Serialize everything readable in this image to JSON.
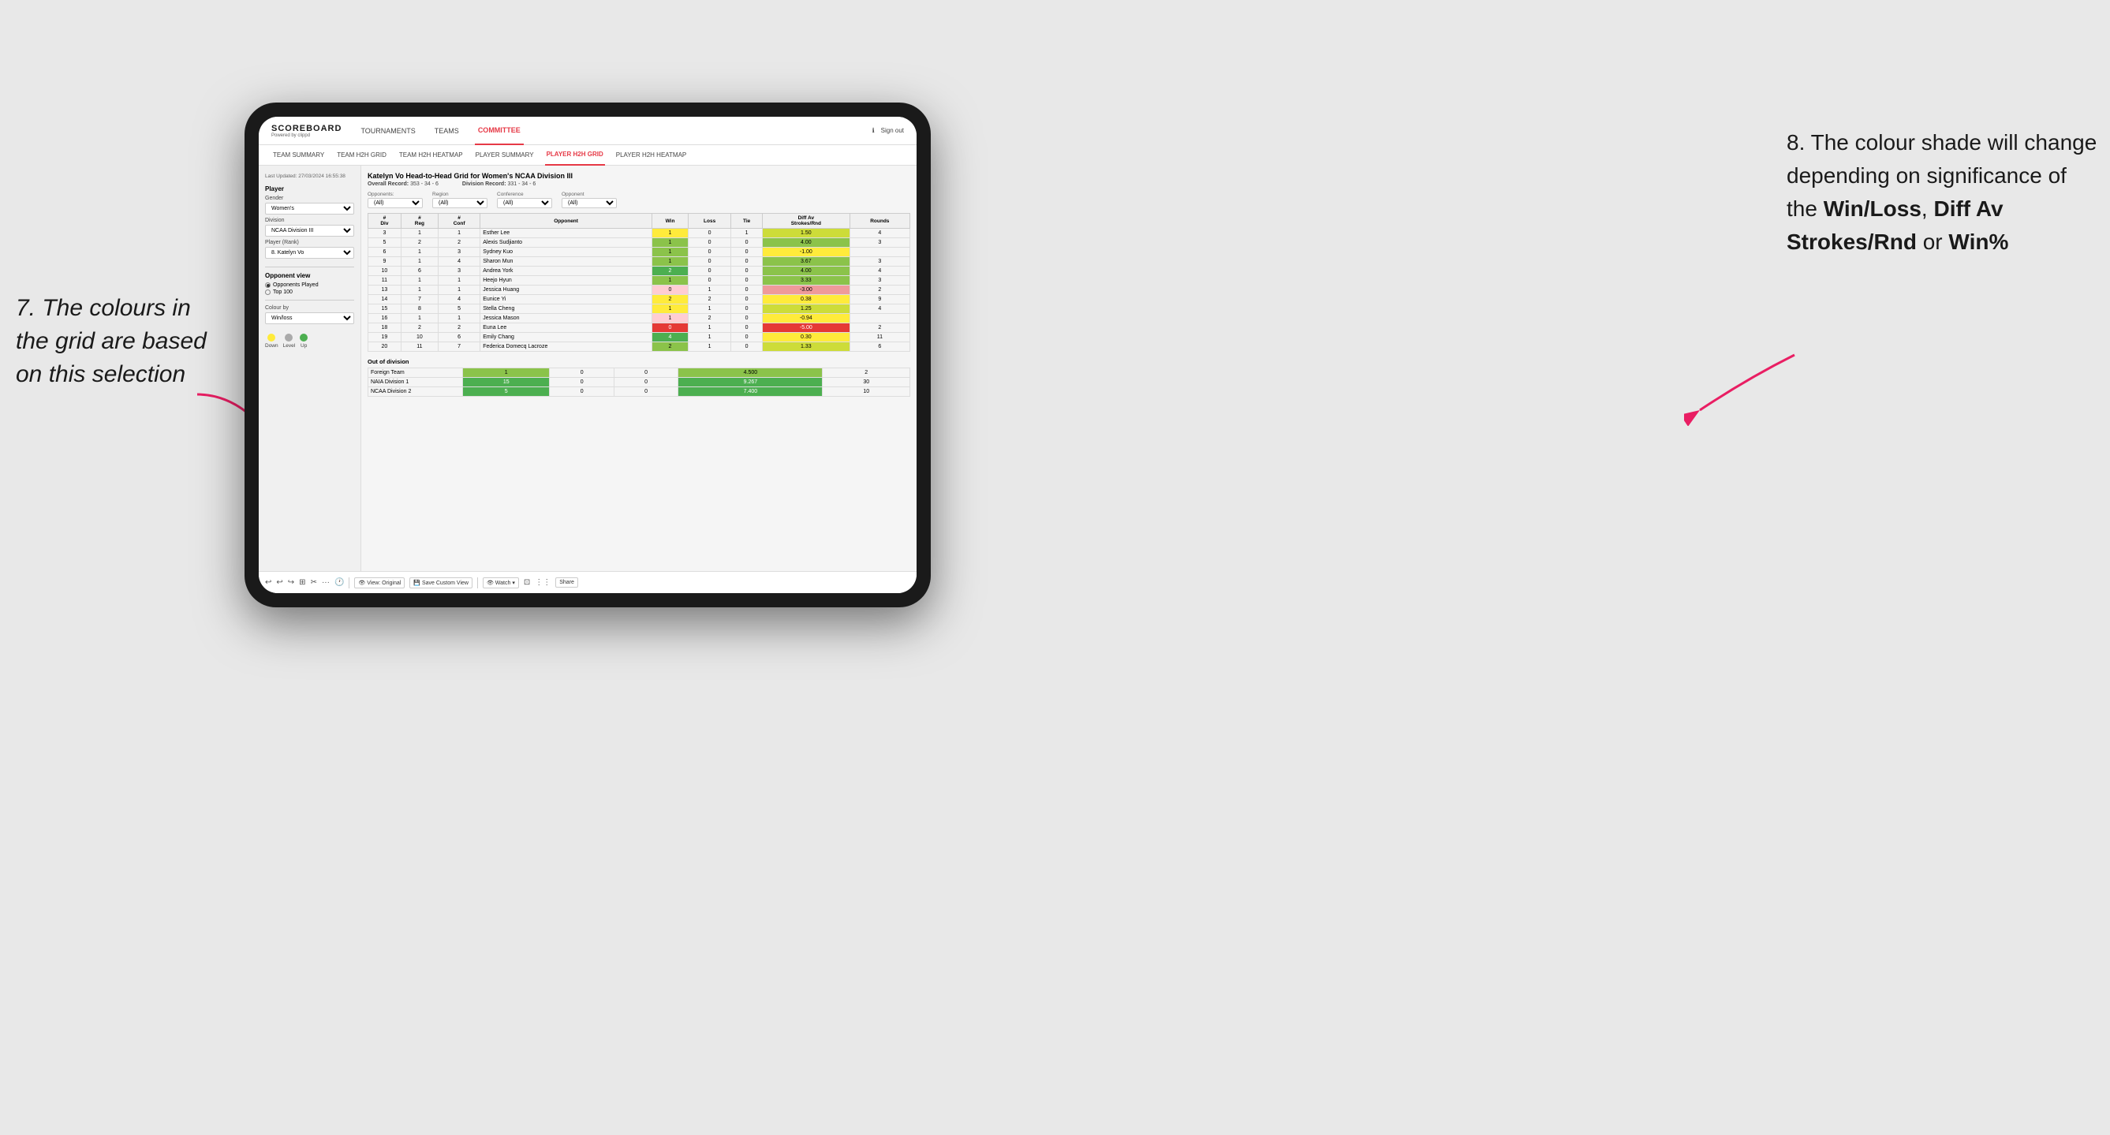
{
  "annotation_left": {
    "line1": "7. The colours in",
    "line2": "the grid are based",
    "line3": "on this selection"
  },
  "annotation_right": {
    "intro": "8. The colour shade will change depending on significance of the ",
    "bold1": "Win/Loss",
    "sep1": ", ",
    "bold2": "Diff Av Strokes/Rnd",
    "sep2": " or ",
    "bold3": "Win%"
  },
  "app": {
    "logo": "SCOREBOARD",
    "logo_sub": "Powered by clippd",
    "nav": [
      "TOURNAMENTS",
      "TEAMS",
      "COMMITTEE"
    ],
    "nav_active": "COMMITTEE",
    "sign_in": "Sign out",
    "sub_nav": [
      "TEAM SUMMARY",
      "TEAM H2H GRID",
      "TEAM H2H HEATMAP",
      "PLAYER SUMMARY",
      "PLAYER H2H GRID",
      "PLAYER H2H HEATMAP"
    ],
    "sub_nav_active": "PLAYER H2H GRID"
  },
  "sidebar": {
    "timestamp": "Last Updated: 27/03/2024 16:55:38",
    "player_label": "Player",
    "gender_label": "Gender",
    "gender_value": "Women's",
    "division_label": "Division",
    "division_value": "NCAA Division III",
    "player_rank_label": "Player (Rank)",
    "player_rank_value": "8. Katelyn Vo",
    "opponent_view_label": "Opponent view",
    "opponent_options": [
      "Opponents Played",
      "Top 100"
    ],
    "opponent_selected": "Opponents Played",
    "colour_by_label": "Colour by",
    "colour_by_value": "Win/loss",
    "legend": {
      "down_label": "Down",
      "level_label": "Level",
      "up_label": "Up"
    }
  },
  "grid": {
    "title": "Katelyn Vo Head-to-Head Grid for Women's NCAA Division III",
    "overall_record_label": "Overall Record:",
    "overall_record": "353 - 34 - 6",
    "division_record_label": "Division Record:",
    "division_record": "331 - 34 - 6",
    "filters": {
      "opponents_label": "Opponents:",
      "opponents_value": "(All)",
      "region_label": "Region",
      "region_value": "(All)",
      "conference_label": "Conference",
      "conference_value": "(All)",
      "opponent_label": "Opponent",
      "opponent_value": "(All)"
    },
    "columns": [
      "#\nDiv",
      "#\nReg",
      "#\nConf",
      "Opponent",
      "Win",
      "Loss",
      "Tie",
      "Diff Av\nStrokes/Rnd",
      "Rounds"
    ],
    "rows": [
      {
        "div": "3",
        "reg": "1",
        "conf": "1",
        "opponent": "Esther Lee",
        "win": "1",
        "loss": "0",
        "tie": "1",
        "diff": "1.50",
        "rounds": "4",
        "win_color": "bg-yellow",
        "diff_color": "bg-green-light"
      },
      {
        "div": "5",
        "reg": "2",
        "conf": "2",
        "opponent": "Alexis Sudjianto",
        "win": "1",
        "loss": "0",
        "tie": "0",
        "diff": "4.00",
        "rounds": "3",
        "win_color": "bg-green-med",
        "diff_color": "bg-green-med"
      },
      {
        "div": "6",
        "reg": "1",
        "conf": "3",
        "opponent": "Sydney Kuo",
        "win": "1",
        "loss": "0",
        "tie": "0",
        "diff": "-1.00",
        "rounds": "",
        "win_color": "bg-green-med",
        "diff_color": "bg-yellow"
      },
      {
        "div": "9",
        "reg": "1",
        "conf": "4",
        "opponent": "Sharon Mun",
        "win": "1",
        "loss": "0",
        "tie": "0",
        "diff": "3.67",
        "rounds": "3",
        "win_color": "bg-green-med",
        "diff_color": "bg-green-med"
      },
      {
        "div": "10",
        "reg": "6",
        "conf": "3",
        "opponent": "Andrea York",
        "win": "2",
        "loss": "0",
        "tie": "0",
        "diff": "4.00",
        "rounds": "4",
        "win_color": "bg-green-dark",
        "diff_color": "bg-green-med"
      },
      {
        "div": "11",
        "reg": "1",
        "conf": "1",
        "opponent": "Heejo Hyun",
        "win": "1",
        "loss": "0",
        "tie": "0",
        "diff": "3.33",
        "rounds": "3",
        "win_color": "bg-green-med",
        "diff_color": "bg-green-med"
      },
      {
        "div": "13",
        "reg": "1",
        "conf": "1",
        "opponent": "Jessica Huang",
        "win": "0",
        "loss": "1",
        "tie": "0",
        "diff": "-3.00",
        "rounds": "2",
        "win_color": "bg-red-light",
        "diff_color": "bg-red-med"
      },
      {
        "div": "14",
        "reg": "7",
        "conf": "4",
        "opponent": "Eunice Yi",
        "win": "2",
        "loss": "2",
        "tie": "0",
        "diff": "0.38",
        "rounds": "9",
        "win_color": "bg-yellow",
        "diff_color": "bg-yellow"
      },
      {
        "div": "15",
        "reg": "8",
        "conf": "5",
        "opponent": "Stella Cheng",
        "win": "1",
        "loss": "1",
        "tie": "0",
        "diff": "1.25",
        "rounds": "4",
        "win_color": "bg-yellow",
        "diff_color": "bg-green-light"
      },
      {
        "div": "16",
        "reg": "1",
        "conf": "1",
        "opponent": "Jessica Mason",
        "win": "1",
        "loss": "2",
        "tie": "0",
        "diff": "-0.94",
        "rounds": "",
        "win_color": "bg-red-light",
        "diff_color": "bg-yellow"
      },
      {
        "div": "18",
        "reg": "2",
        "conf": "2",
        "opponent": "Euna Lee",
        "win": "0",
        "loss": "1",
        "tie": "0",
        "diff": "-5.00",
        "rounds": "2",
        "win_color": "bg-red-dark",
        "diff_color": "bg-red-dark"
      },
      {
        "div": "19",
        "reg": "10",
        "conf": "6",
        "opponent": "Emily Chang",
        "win": "4",
        "loss": "1",
        "tie": "0",
        "diff": "0.30",
        "rounds": "11",
        "win_color": "bg-green-dark",
        "diff_color": "bg-yellow"
      },
      {
        "div": "20",
        "reg": "11",
        "conf": "7",
        "opponent": "Federica Domecq Lacroze",
        "win": "2",
        "loss": "1",
        "tie": "0",
        "diff": "1.33",
        "rounds": "6",
        "win_color": "bg-green-med",
        "diff_color": "bg-green-light"
      }
    ],
    "out_of_division_label": "Out of division",
    "out_of_division_rows": [
      {
        "opponent": "Foreign Team",
        "win": "1",
        "loss": "0",
        "tie": "0",
        "diff": "4.500",
        "rounds": "2",
        "win_color": "bg-green-med",
        "diff_color": "bg-green-med"
      },
      {
        "opponent": "NAIA Division 1",
        "win": "15",
        "loss": "0",
        "tie": "0",
        "diff": "9.267",
        "rounds": "30",
        "win_color": "bg-green-dark",
        "diff_color": "bg-green-dark"
      },
      {
        "opponent": "NCAA Division 2",
        "win": "5",
        "loss": "0",
        "tie": "0",
        "diff": "7.400",
        "rounds": "10",
        "win_color": "bg-green-dark",
        "diff_color": "bg-green-dark"
      }
    ]
  },
  "toolbar": {
    "items": [
      "↩",
      "↩",
      "↪",
      "⊞",
      "✂",
      "·",
      "🕐",
      "|",
      "👁 View: Original",
      "💾 Save Custom View",
      "👁 Watch ▾",
      "⊡",
      "⋮⋮",
      "Share"
    ]
  }
}
